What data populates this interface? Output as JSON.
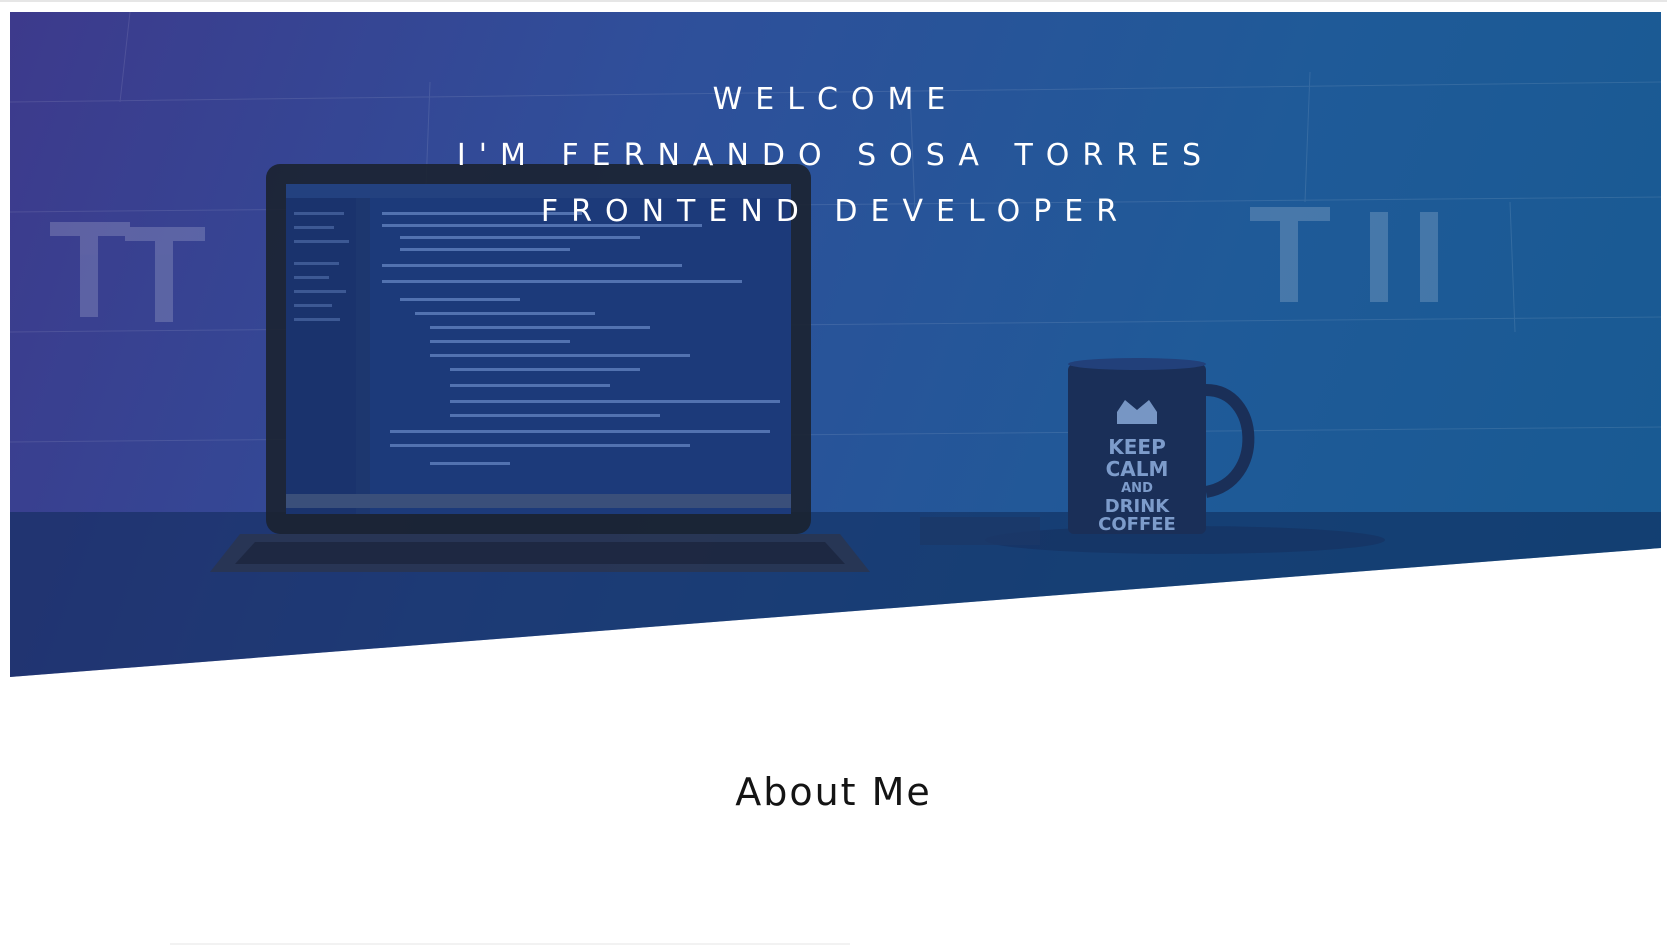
{
  "hero": {
    "line1": "WELCOME",
    "line2": "I'M FERNANDO SOSA TORRES",
    "line3": "FRONTEND DEVELOPER",
    "mug_text": [
      "KEEP",
      "CALM",
      "AND",
      "DRINK",
      "COFFEE"
    ]
  },
  "about": {
    "title": "About Me"
  },
  "colors": {
    "hero_gradient_start": "#3d3a8c",
    "hero_gradient_end": "#185a92",
    "hero_text": "#ffffff",
    "title_text": "#141414"
  }
}
